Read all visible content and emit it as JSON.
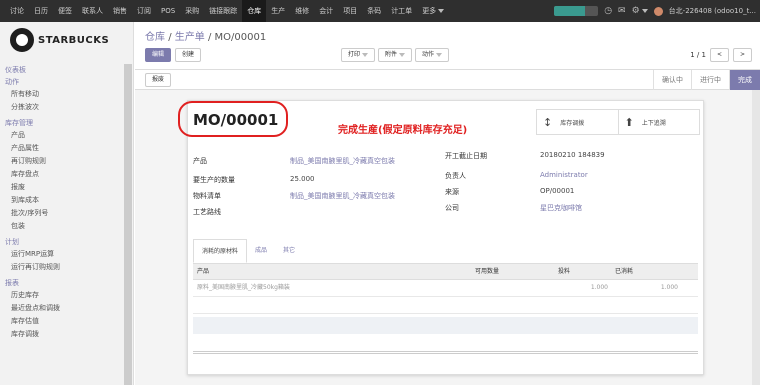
{
  "topbar": {
    "menus": [
      "讨论",
      "日历",
      "便签",
      "联系人",
      "销售",
      "订阅",
      "POS",
      "采购",
      "链接跟踪",
      "仓库",
      "生产",
      "维修",
      "会计",
      "项目",
      "条码",
      "计工单",
      "更多"
    ],
    "active_menu": "仓库",
    "user": "台北-226408 (odoo10_t..."
  },
  "sidebar": {
    "logo_text": "STARBUCKS",
    "groups": [
      {
        "title": "仪表板",
        "items": []
      },
      {
        "title": "动作",
        "items": [
          "所有移动",
          "分拣波次"
        ]
      },
      {
        "title": "库存管理",
        "items": [
          "产品",
          "产品属性",
          "再订购规则",
          "库存盘点",
          "报废",
          "到库成本",
          "批次/序列号",
          "包装"
        ]
      },
      {
        "title": "计划",
        "items": [
          "运行MRP运算",
          "运行再订购规则"
        ]
      },
      {
        "title": "报表",
        "items": [
          "历史库存",
          "最近盘点和调拨",
          "库存估值",
          "库存调拨"
        ]
      }
    ]
  },
  "breadcrumb": {
    "part1": "仓库",
    "part2": "生产单",
    "current": "MO/00001"
  },
  "toolbar": {
    "edit": "编辑",
    "create": "创建",
    "print": "打印",
    "attachment": "附件",
    "action": "动作",
    "pager": "1 / 1"
  },
  "statusbar": {
    "button": "报废",
    "stages": [
      "确认中",
      "进行中",
      "完成"
    ],
    "active_stage": "完成"
  },
  "sheet": {
    "title": "MO/00001",
    "annotation": "完成生産(假定原料库存充足)",
    "smart_buttons": [
      "库存调拨",
      "上下追溯"
    ],
    "fields_left": [
      {
        "label": "产品",
        "value": "制品_美国南腋里肌_冷藏真空包装"
      },
      {
        "label": "要生产的数量",
        "value": "25.000"
      },
      {
        "label": "物料清单",
        "value": "制品_美国南腋里肌_冷藏真空包装"
      },
      {
        "label": "工艺路线",
        "value": ""
      }
    ],
    "fields_right": [
      {
        "label": "开工截止日期",
        "value": "20180210 184839"
      },
      {
        "label": "负责人",
        "value": "Administrator"
      },
      {
        "label": "来源",
        "value": "OP/00001"
      },
      {
        "label": "公司",
        "value": "星巴克咖啡馆"
      }
    ],
    "tabs": [
      "消耗的原材料",
      "成品",
      "其它"
    ],
    "table": {
      "headers": [
        "产品",
        "可用数量",
        "投料",
        "已消耗"
      ],
      "rows": [
        {
          "product": "原料_美国南腋里肌_冷藏50kg箱装",
          "available": "",
          "to_consume": "1.000",
          "consumed": "1.000"
        }
      ]
    }
  },
  "colors": {
    "accent": "#7c7bad",
    "annotation": "#e02020",
    "topbar": "#2f2f2f"
  }
}
